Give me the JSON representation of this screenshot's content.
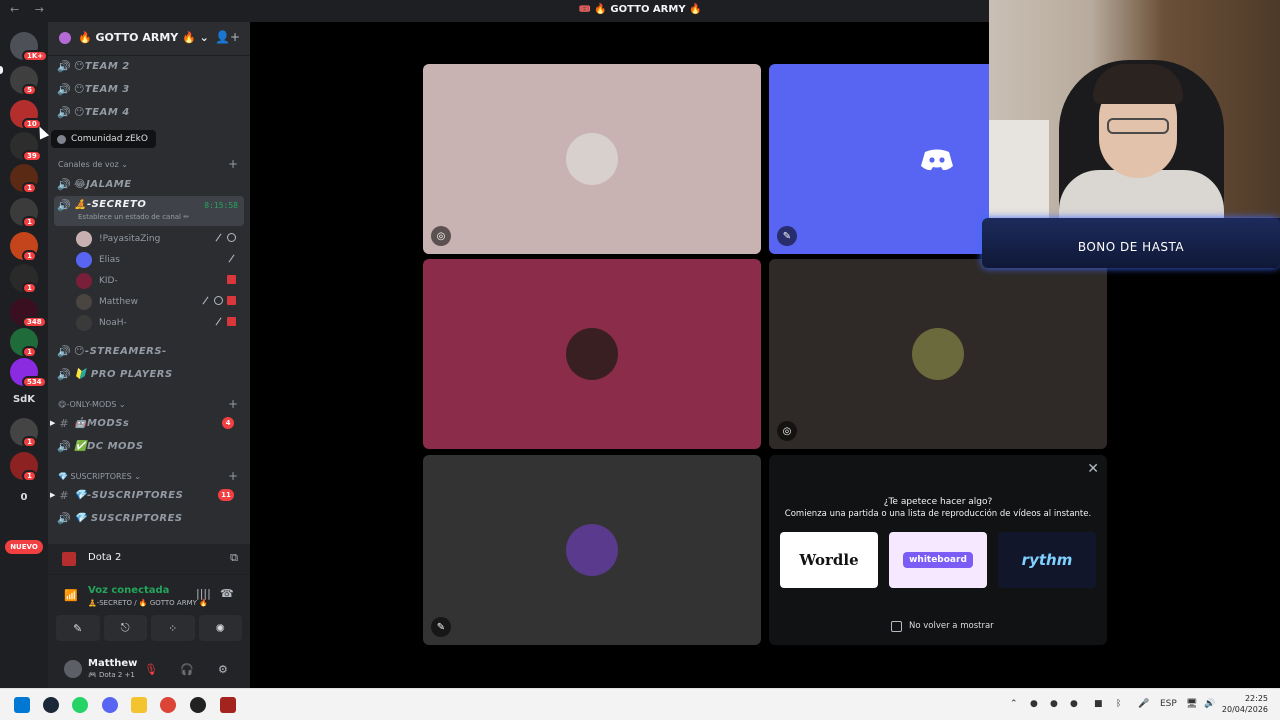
{
  "window": {
    "title": "🎟️ 🔥 GOTTO ARMY 🔥",
    "nav": "← →"
  },
  "servers": [
    {
      "label": "",
      "badge": "1K+"
    },
    {
      "label": "",
      "badge": "5"
    },
    {
      "label": "",
      "badge": "10"
    },
    {
      "label": "",
      "badge": "39"
    },
    {
      "label": "",
      "badge": "1"
    },
    {
      "label": "",
      "badge": "1"
    },
    {
      "label": "",
      "badge": "1"
    },
    {
      "label": "",
      "badge": "1"
    },
    {
      "label": "",
      "badge": "348"
    },
    {
      "label": "",
      "badge": "1"
    },
    {
      "label": "",
      "badge": "534"
    },
    {
      "label": "SdK",
      "badge": ""
    },
    {
      "label": "",
      "badge": "1"
    },
    {
      "label": "",
      "badge": "1"
    },
    {
      "label": "0",
      "badge": ""
    }
  ],
  "nuevo_label": "NUEVO",
  "guild": {
    "name": "🔥 GOTTO ARMY 🔥 ⌄",
    "invite_icon": "👤+"
  },
  "tooltip": "Comunidad zEkO",
  "channels_top": [
    {
      "icon": "🔊",
      "label": "😶TEAM 2"
    },
    {
      "icon": "🔊",
      "label": "😶TEAM 3"
    },
    {
      "icon": "🔊",
      "label": "😶TEAM 4"
    }
  ],
  "voice_category": {
    "label": "Canales de voz ⌄",
    "plus": "+"
  },
  "voice_channels": [
    {
      "icon": "🔊",
      "label": "😂JALAME"
    },
    {
      "icon": "🔊",
      "label": "🧘-SECRETO",
      "timer": "8:15:58",
      "sub": "Establece un estado de canal ✏"
    }
  ],
  "voice_users": [
    {
      "name": "!PayasitaZing",
      "color": "#c9b0b0"
    },
    {
      "name": "Elias",
      "color": "#5865f2"
    },
    {
      "name": "KID-",
      "color": "#7a1f3a"
    },
    {
      "name": "Matthew",
      "color": "#4a4540"
    },
    {
      "name": "NoaH-",
      "color": "#3a3a3a"
    }
  ],
  "channels_mid": [
    {
      "icon": "🔊",
      "label": "😶-STREAMERS-"
    },
    {
      "icon": "🔊",
      "label": "🔰 PRO PLAYERS"
    }
  ],
  "mods_category": {
    "label": "😋-ONLY-MODS ⌄",
    "plus": "+"
  },
  "mods_channels": [
    {
      "icon": "#",
      "label": "🤖MODSs",
      "badge": "4"
    },
    {
      "icon": "🔊",
      "label": "✅DC MODS",
      "badge": ""
    }
  ],
  "subs_category": {
    "label": "💎 SUSCRIPTORES ⌄",
    "plus": "+"
  },
  "subs_channels": [
    {
      "icon": "#",
      "label": "💎-SUSCRIPTORES",
      "badge": "11"
    },
    {
      "icon": "🔊",
      "label": "💎 SUSCRIPTORES",
      "badge": ""
    }
  ],
  "activity": {
    "name": "Dota 2",
    "side_icon": "⧉"
  },
  "voice_panel": {
    "status": "Voz conectada",
    "channel": "🧘-SECRETO / 🔥 GOTTO ARMY 🔥",
    "signal_icon": "📶",
    "buttons": [
      "✎",
      "⎋",
      "⁘",
      "✺"
    ],
    "noise_icon": "||||",
    "hangup_icon": "☎"
  },
  "user_panel": {
    "name": "Matthew",
    "status": "🎮 Dota 2 +1",
    "mic_icon": "🎙",
    "deafen_icon": "🎧",
    "settings_icon": "⚙"
  },
  "tiles": [
    {
      "bg": "#c9b3b2",
      "avatar": "#d8d0cc",
      "badge": "◎"
    },
    {
      "bg": "#5865f2",
      "avatar": "",
      "badge": "✎"
    },
    {
      "bg": "#8a2c4a",
      "avatar": "#3a1f22",
      "badge": ""
    },
    {
      "bg": "#2f2a27",
      "avatar": "#6b6a3c",
      "badge": "◎"
    },
    {
      "bg": "#333333",
      "avatar": "#5a3a8c",
      "badge": "✎"
    }
  ],
  "promo": {
    "close": "✕",
    "heading": "¿Te apetece hacer algo?",
    "subheading": "Comienza una partida o una lista de reproducción de vídeos al instante.",
    "cards": [
      "Wordle",
      "whiteboard",
      "rythm"
    ],
    "checkbox_label": "No volver a mostrar"
  },
  "webcam_banner": "BONO DE HASTA",
  "taskbar": {
    "tray_lang": "ESP",
    "time": "22:25",
    "date": "20/04/2026"
  },
  "colors": {
    "accent": "#5865f2",
    "online": "#23a55a",
    "danger": "#f23f42"
  }
}
